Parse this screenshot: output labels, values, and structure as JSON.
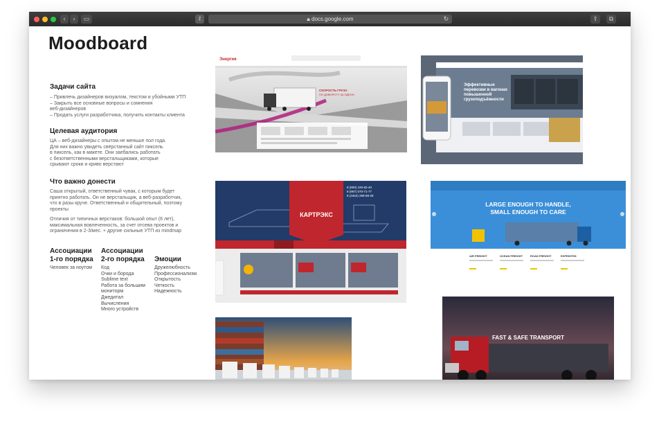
{
  "browser": {
    "url": "docs.google.com"
  },
  "sidebar": {
    "title": "Moodboard",
    "goals_heading": "Задачи сайта",
    "goals_lines": [
      "– Привлечь дизайнеров визуалом, текстом и убойными УТП",
      "– Закрыть все основные вопросы и сомнения",
      "веб-дизайнеров",
      "– Продать услуги разработчика, получить контакты клиента"
    ],
    "audience_heading": "Целевая аудитория",
    "audience_lines": [
      "ЦА – веб-дизайнеры с опытом не меньше пол года.",
      "Для них важно увидеть свёрстанный сайт пиксель",
      "в пиксель, как в макете. Они заебались работать",
      "с безответственными верстальщиками, которые",
      "срывают сроки и криво верстают"
    ],
    "message_heading": "Что важно донести",
    "message_lines_1": [
      "Саша открытый, ответственный чувак, с которым будет",
      "приятно работать. Он не верстальщик, а веб-разработчик,",
      "что в разы круче. Ответственный и общительный, поэтому",
      "проекты"
    ],
    "message_lines_2": [
      "Отличия от типичных верстаков: большой опыт (6 лет),",
      "максимальная вовлеченность, за счет отсева проектов и",
      "ограничения в 2-3/мес. + другие сильные УТП из mindmap"
    ],
    "assoc1_heading_1": "Ассоциации",
    "assoc1_heading_2": "1-го порядка",
    "assoc1_items": [
      "Человек за ноутом"
    ],
    "assoc2_heading_1": "Ассоциации",
    "assoc2_heading_2": "2-го порядка",
    "assoc2_items": [
      "Код",
      "Очки и борода",
      "Sublime text",
      "Работа за большим",
      "мониторм",
      "Джедитал",
      "Вычисления",
      "Много устройств"
    ],
    "emotions_heading": "Эмоции",
    "emotions_items": [
      "Дружелюбность",
      "Профессионализм",
      "Открытость",
      "Четкость",
      "Надежность"
    ]
  },
  "moodboard": {
    "img1_tagline_1": "СКОРОСТЬ ГРУЗА",
    "img1_tagline_2": "ПО ДОВОРОТУ ЗА ПДЕНН",
    "img2_headline": [
      "Эффективные",
      "перевозки в вагонах",
      "повышенной",
      "грузоподъёмности"
    ],
    "img3_brand": "КАРТРЭКС",
    "img3_phones": [
      "8 (800) 100-82-40",
      "8 (967) 070-71-77",
      "8 (3452) 288-88-28"
    ],
    "img4_headline_1": "LARGE ENOUGH TO HANDLE,",
    "img4_headline_2": "SMALL ENOUGH TO CARE",
    "img4_services": [
      "AIR FREIGHT",
      "OCEAN FREIGHT",
      "ROAD FREIGHT",
      "EXPEDITED"
    ],
    "img6_headline": "FAST & SAFE TRANSPORT"
  },
  "colors": {
    "brand_red": "#c0262d",
    "brand_blue": "#3b8fd8",
    "navy": "#223b68"
  }
}
